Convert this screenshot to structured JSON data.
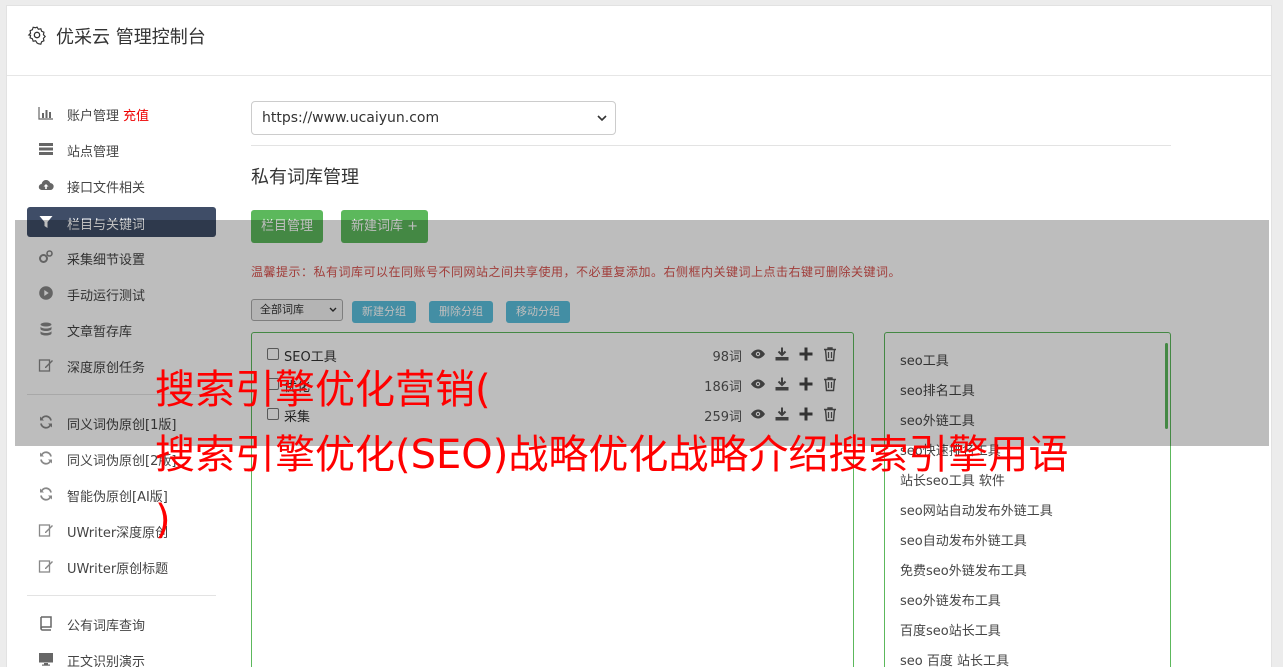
{
  "header": {
    "title": "优采云 管理控制台",
    "icon": "gear-icon"
  },
  "sidebar": {
    "items": [
      {
        "label": "账户管理",
        "extra": "充值",
        "icon": "bar-chart-icon"
      },
      {
        "label": "站点管理",
        "icon": "server-icon"
      },
      {
        "label": "接口文件相关",
        "icon": "cloud-upload-icon"
      },
      {
        "label": "栏目与关键词",
        "icon": "filter-icon",
        "active": true
      },
      {
        "label": "采集细节设置",
        "icon": "cogs-icon"
      },
      {
        "label": "手动运行测试",
        "icon": "play-circle-icon"
      },
      {
        "label": "文章暂存库",
        "icon": "database-icon"
      },
      {
        "label": "深度原创任务",
        "icon": "edit-icon"
      },
      {
        "label": "同义词伪原创[1版]",
        "icon": "refresh-icon"
      },
      {
        "label": "同义词伪原创[2版]",
        "icon": "refresh-icon"
      },
      {
        "label": "智能伪原创[AI版]",
        "icon": "refresh-icon"
      },
      {
        "label": "UWriter深度原创",
        "icon": "edit-icon"
      },
      {
        "label": "UWriter原创标题",
        "icon": "edit-icon"
      },
      {
        "label": "公有词库查询",
        "icon": "book-icon"
      },
      {
        "label": "正文识别演示",
        "icon": "monitor-icon"
      }
    ]
  },
  "main": {
    "site_select": {
      "value": "https://www.ucaiyun.com"
    },
    "section_title": "私有词库管理",
    "buttons": {
      "column_manage": "栏目管理",
      "new_library": "新建词库 +"
    },
    "tip": "温馨提示：私有词库可以在同账号不同网站之间共享使用，不必重复添加。右侧框内关键词上点击右键可删除关键词。",
    "filter_select": {
      "value": "全部词库"
    },
    "group_buttons": {
      "new_group": "新建分组",
      "delete_group": "删除分组",
      "move_group": "移动分组"
    },
    "groups": [
      {
        "name": "SEO工具",
        "count": "98词"
      },
      {
        "name": "优化",
        "count": "186词"
      },
      {
        "name": "采集",
        "count": "259词"
      }
    ],
    "keywords": [
      "seo工具",
      "seo排名工具",
      "seo外链工具",
      "seo快速排名工具",
      "站长seo工具 软件",
      "seo网站自动发布外链工具",
      "seo自动发布外链工具",
      "免费seo外链发布工具",
      "seo外链发布工具",
      "百度seo站长工具",
      "seo 百度 站长工具"
    ]
  },
  "headline": {
    "line1": "搜索引擎优化营销(",
    "line2": "搜索引擎优化(SEO)战略优化战略介绍搜索引擎用语",
    "line3": ")"
  },
  "colors": {
    "accent_green": "#5cb85c",
    "accent_blue": "#5bc0de",
    "nav_active_bg": "#3f4d67",
    "headline_red": "#ff0000",
    "tip_red": "#d9534f"
  }
}
